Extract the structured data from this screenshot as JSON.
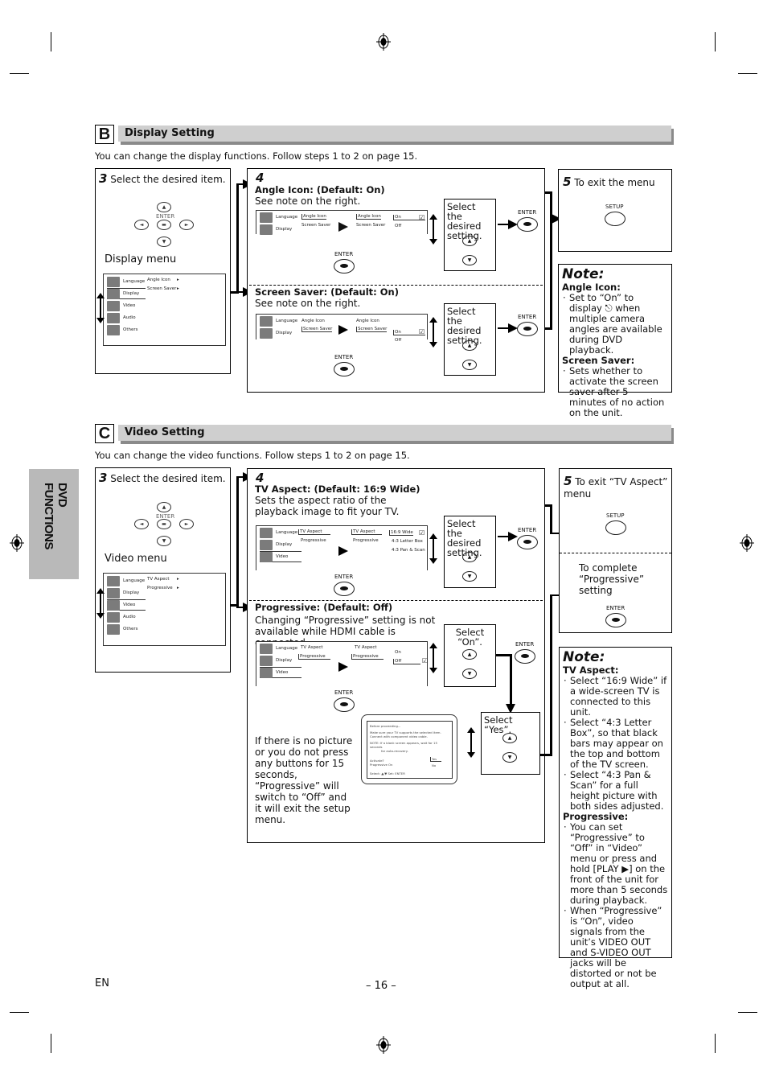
{
  "page": {
    "language_tag": "EN",
    "page_number": "– 16 –"
  },
  "sidebar": {
    "label": "DVD FUNCTIONS"
  },
  "section_b": {
    "letter": "B",
    "title": "Display Setting",
    "intro": "You can change the display functions. Follow steps 1 to 2 on page 15.",
    "step3": {
      "num": "3",
      "label": "Select the desired item.",
      "enter_caption": "ENTER",
      "menu_title": "Display menu",
      "menu_items": [
        "Language",
        "Display",
        "Video",
        "Audio",
        "Others"
      ],
      "submenu_items": [
        "Angle Icon",
        "Screen Saver"
      ]
    },
    "step4": {
      "num": "4",
      "angle": {
        "heading": "Angle Icon: (Default: On)",
        "desc": "See note on the right.",
        "left_menu": [
          "Language",
          "Display"
        ],
        "sub": [
          "Angle Icon",
          "Screen Saver"
        ],
        "options": [
          "On",
          "Off"
        ],
        "bubble": "Select the desired setting.",
        "enter": "ENTER"
      },
      "saver": {
        "heading": "Screen Saver: (Default: On)",
        "desc": "See note on the right.",
        "left_menu": [
          "Language",
          "Display"
        ],
        "sub": [
          "Angle Icon",
          "Screen Saver"
        ],
        "options": [
          "On",
          "Off"
        ],
        "bubble": "Select the desired setting.",
        "enter": "ENTER"
      }
    },
    "step5": {
      "num": "5",
      "label": "To exit the menu",
      "button": "SETUP"
    },
    "note": {
      "title": "Note:",
      "groups": [
        {
          "heading": "Angle Icon:",
          "items": [
            "Set to “On” to display ⎋ when multiple camera angles are available during DVD playback."
          ]
        },
        {
          "heading": "Screen Saver:",
          "items": [
            "Sets whether to activate the screen saver after 5 minutes of no action on the unit."
          ]
        }
      ]
    }
  },
  "section_c": {
    "letter": "C",
    "title": "Video Setting",
    "intro": "You can change the video functions. Follow steps 1 to 2 on page 15.",
    "step3": {
      "num": "3",
      "label": "Select the desired item.",
      "enter_caption": "ENTER",
      "menu_title": "Video menu",
      "menu_items": [
        "Language",
        "Display",
        "Video",
        "Audio",
        "Others"
      ],
      "submenu_items": [
        "TV Aspect",
        "Progressive"
      ]
    },
    "step4": {
      "num": "4",
      "aspect": {
        "heading": "TV Aspect: (Default: 16:9 Wide)",
        "desc": "Sets the aspect ratio of the playback image to fit your TV.",
        "left_menu": [
          "Language",
          "Display",
          "Video"
        ],
        "sub": [
          "TV Aspect",
          "Progressive"
        ],
        "options": [
          "16:9 Wide",
          "4:3 Letter Box",
          "4:3 Pan & Scan"
        ],
        "bubble": "Select the desired setting.",
        "enter": "ENTER"
      },
      "progressive": {
        "heading": "Progressive: (Default: Off)",
        "desc": "Changing “Progressive” setting is not available while HDMI cable is connected.",
        "left_menu": [
          "Language",
          "Display",
          "Video"
        ],
        "sub": [
          "TV Aspect",
          "Progressive"
        ],
        "options": [
          "On",
          "Off"
        ],
        "bubble": "Select “On”.",
        "enter": "ENTER",
        "dialog": {
          "line1": "Before proceeding...",
          "line2": "Make sure your TV supports the selected item.",
          "line3": "Connect with component video cable.",
          "line4": "NOTE:  If a blank screen appears, wait for 15 seconds",
          "line5": "for auto-recovery.",
          "line6": "Activate?",
          "line7": "Progressive    On",
          "yes": "Yes",
          "no": "No",
          "line8": "Select: ▲/▼          Set: ENTER"
        },
        "yes_bubble": "Select “Yes”.",
        "timeout_note": "If there is no picture or you do not press any buttons for 15 seconds, “Progressive” will switch to “Off” and it will exit the setup menu."
      }
    },
    "step5": {
      "num": "5",
      "label": "To exit “TV Aspect” menu",
      "button": "SETUP",
      "complete_label": "To complete “Progressive” setting",
      "complete_button": "ENTER"
    },
    "note": {
      "title": "Note:",
      "groups": [
        {
          "heading": "TV Aspect:",
          "items": [
            "Select “16:9 Wide” if a wide-screen TV is connected to this unit.",
            "Select “4:3 Letter Box”, so that black bars may appear on the top and bottom of the TV screen.",
            "Select “4:3 Pan & Scan” for a full height picture with both sides adjusted."
          ]
        },
        {
          "heading": "Progressive:",
          "items": [
            "You can set “Progressive” to “Off” in “Video” menu or press and hold [PLAY ▶] on the front of the unit for more than 5 seconds during playback.",
            "When “Progressive” is “On”, video signals from the unit’s VIDEO OUT and S-VIDEO OUT jacks will be distorted or not be output at all."
          ]
        }
      ]
    }
  }
}
